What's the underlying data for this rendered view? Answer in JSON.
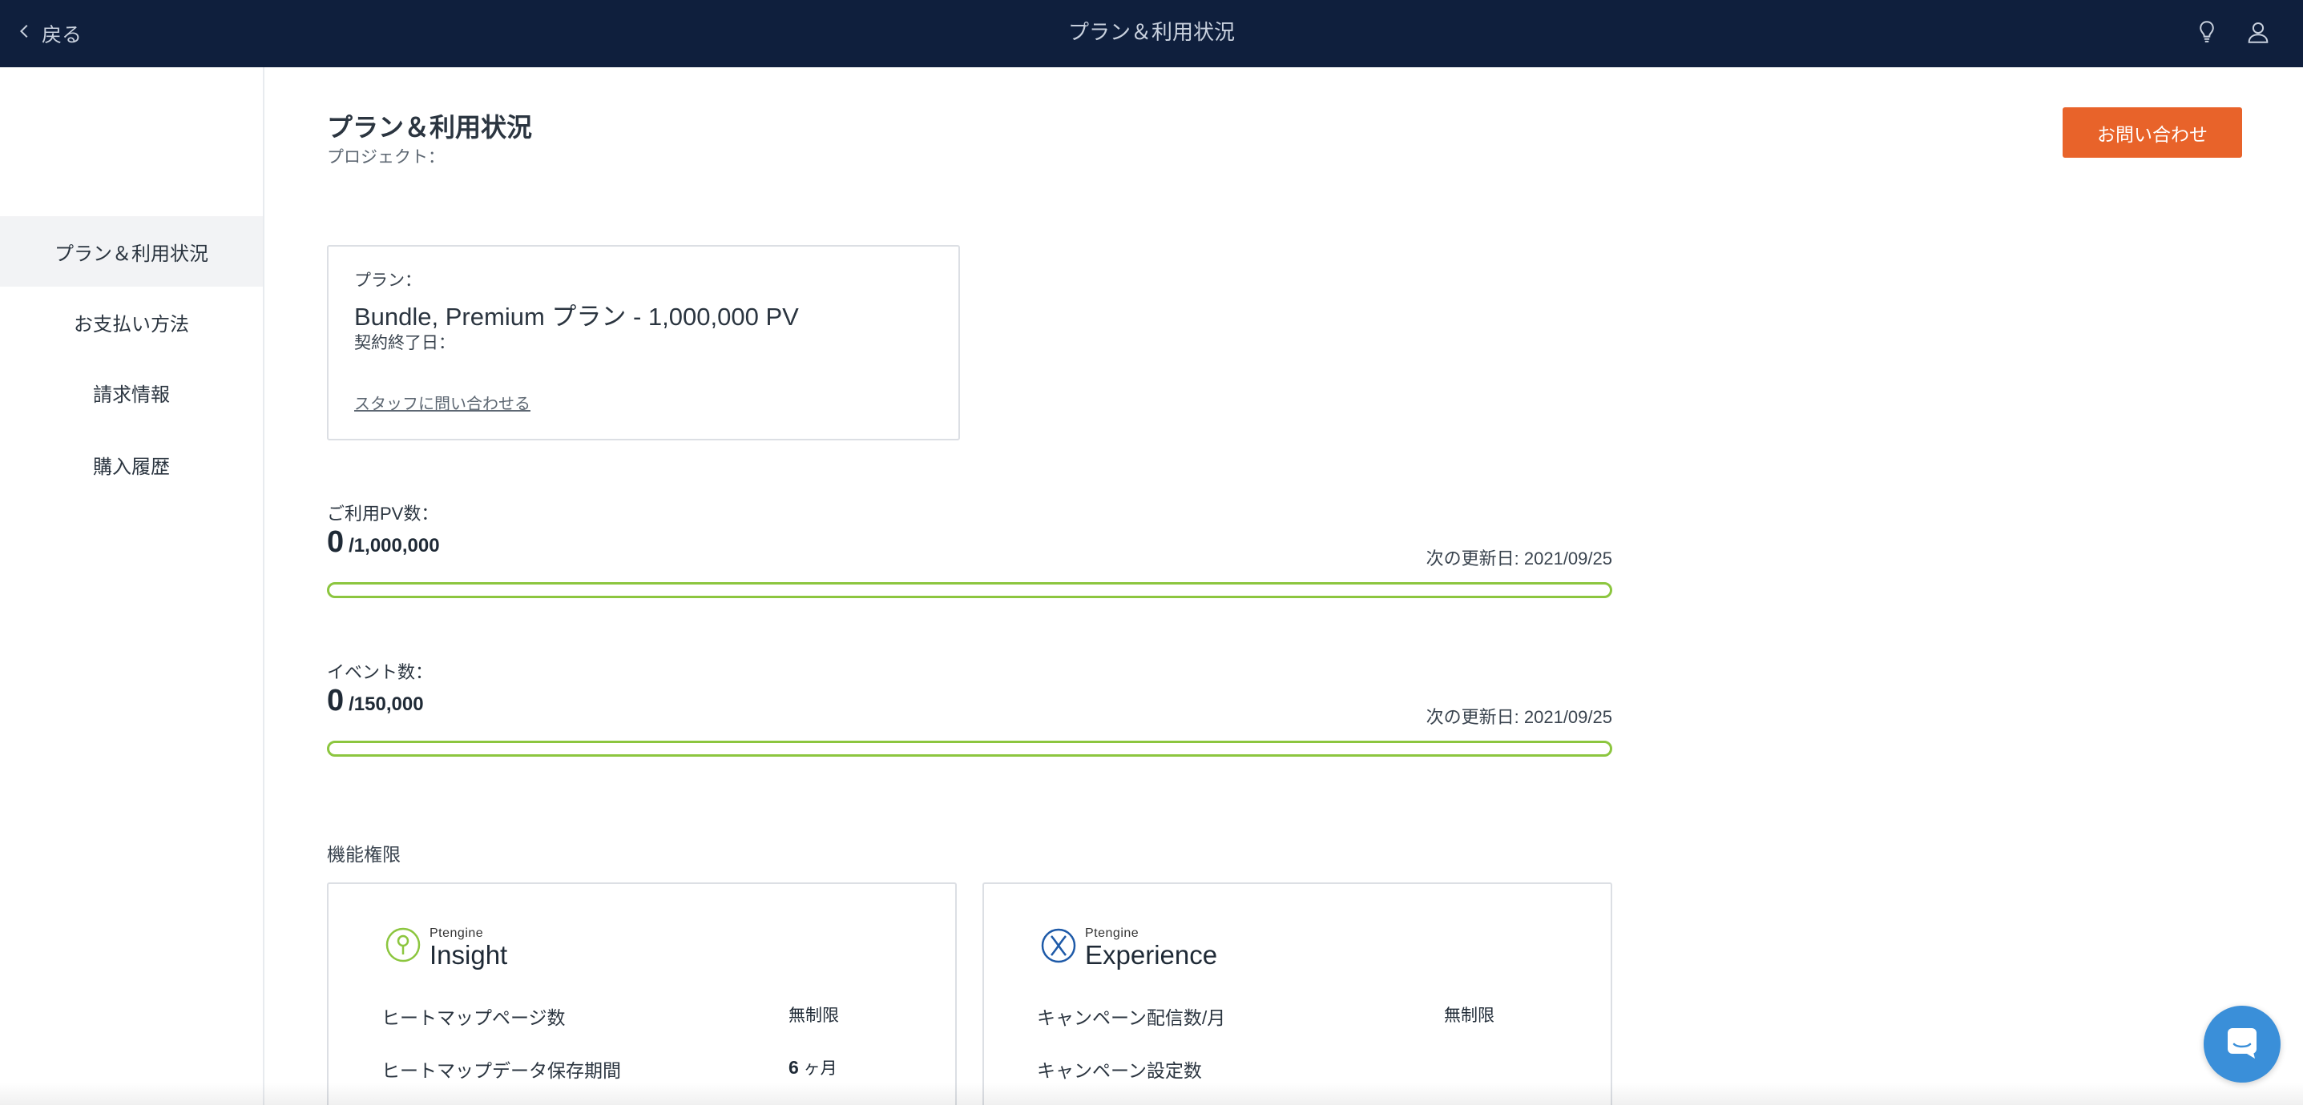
{
  "topbar": {
    "back_label": "戻る",
    "title": "プラン＆利用状況",
    "icons": [
      "chevron-left-icon",
      "lightbulb-icon",
      "user-icon"
    ]
  },
  "sidebar": {
    "items": [
      {
        "label": "プラン＆利用状況",
        "active": true
      },
      {
        "label": "お支払い方法",
        "active": false
      },
      {
        "label": "請求情報",
        "active": false
      },
      {
        "label": "購入履歴",
        "active": false
      }
    ]
  },
  "header": {
    "title": "プラン＆利用状況",
    "subtitle": "プロジェクト：",
    "contact_button": "お問い合わせ"
  },
  "plan": {
    "label": "プラン：",
    "name": "Bundle, Premium プラン - 1,000,000 PV",
    "end_label": "契約終了日：",
    "link": "スタッフに問い合わせる"
  },
  "usage": {
    "pv": {
      "label": "ご利用PV数：",
      "used": "0",
      "limit": "/1,000,000",
      "next_update": "次の更新日: 2021/09/25",
      "fraction": 0
    },
    "events": {
      "label": "イベント数：",
      "used": "0",
      "limit": "/150,000",
      "next_update": "次の更新日: 2021/09/25",
      "fraction": 0
    },
    "bar_color": "#8cc63f"
  },
  "features": {
    "section_label": "機能権限",
    "insight": {
      "brand_small": "Ptengine",
      "brand_big": "Insight",
      "icon": "insight-bulb-icon",
      "rows": [
        {
          "name": "ヒートマップページ数",
          "value": "無制限",
          "unit": ""
        },
        {
          "name": "ヒートマップデータ保存期間",
          "value": "6",
          "unit": " ヶ月"
        }
      ]
    },
    "experience": {
      "brand_small": "Ptengine",
      "brand_big": "Experience",
      "icon": "experience-x-icon",
      "rows": [
        {
          "name": "キャンペーン配信数/月",
          "value": "無制限",
          "unit": ""
        },
        {
          "name": "キャンペーン設定数",
          "value": "",
          "unit": ""
        }
      ]
    }
  },
  "colors": {
    "topbar": "#0f1f3d",
    "accent": "#e8632a",
    "progress": "#8cc63f",
    "chat": "#3a8fd9"
  }
}
